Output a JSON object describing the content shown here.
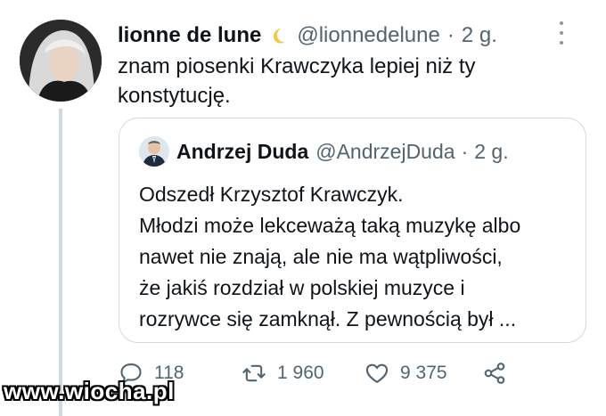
{
  "tweet": {
    "author_name": "lionne de lune",
    "author_handle": "@lionnedelune",
    "age_separator": "·",
    "age": "2 g.",
    "text_lines": [
      "znam piosenki Krawczyka lepiej niż ty",
      "konstytucję."
    ],
    "name_emoji_icon": "crescent-moon-icon",
    "more_icon": "more-options-icon"
  },
  "quoted_tweet": {
    "author_name": "Andrzej Duda",
    "author_handle": "@AndrzejDuda",
    "age_separator": "·",
    "age": "2 g.",
    "text_lines": [
      "Odszedł Krzysztof Krawczyk.",
      "Młodzi może lekceważą taką muzykę albo",
      "nawet nie znają, ale nie ma wątpliwości,",
      "że jakiś rozdział w polskiej muzyce i",
      "rozrywce się zamknął. Z pewnością był ..."
    ]
  },
  "actions": {
    "reply_count": "118",
    "retweet_count": "1 960",
    "like_count": "9 375",
    "icons": [
      "reply-icon",
      "retweet-icon",
      "like-icon",
      "share-icon"
    ]
  },
  "watermark": {
    "text": "www.wiocha.pl"
  },
  "colors": {
    "text_primary": "#0f1419",
    "text_secondary": "#536471",
    "border": "#cfd9de",
    "moon": "#f5c842"
  }
}
